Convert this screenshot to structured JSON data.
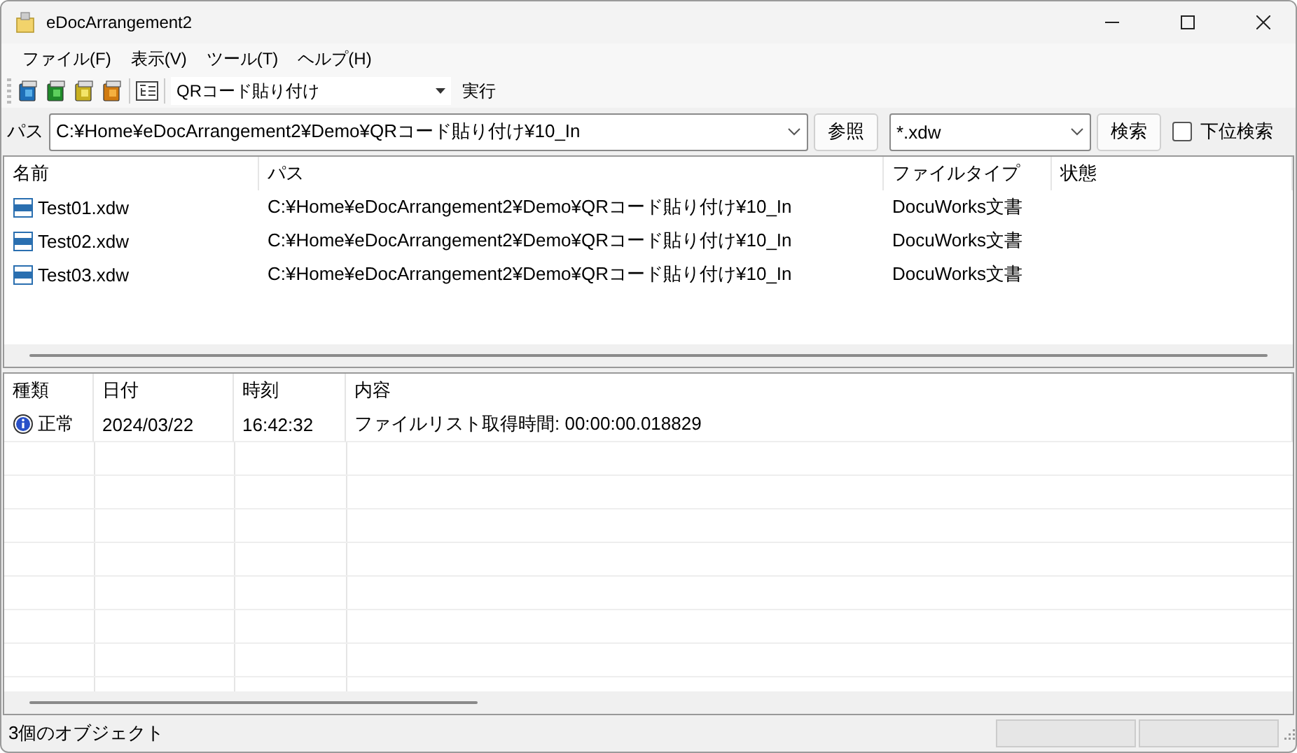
{
  "window": {
    "title": "eDocArrangement2"
  },
  "menu": [
    "ファイル(F)",
    "表示(V)",
    "ツール(T)",
    "ヘルプ(H)"
  ],
  "toolbar": {
    "action_combo": {
      "value": "QRコード貼り付け"
    },
    "run_button": "実行"
  },
  "path_bar": {
    "label": "パス",
    "path": "C:¥Home¥eDocArrangement2¥Demo¥QRコード貼り付け¥10_In",
    "browse_button": "参照",
    "filter": "*.xdw",
    "search_button": "検索",
    "subfolder_checkbox": {
      "label": "下位検索",
      "checked": false
    }
  },
  "file_list": {
    "columns": [
      "名前",
      "パス",
      "ファイルタイプ",
      "状態"
    ],
    "rows": [
      {
        "name": "Test01.xdw",
        "path": "C:¥Home¥eDocArrangement2¥Demo¥QRコード貼り付け¥10_In",
        "type": "DocuWorks文書"
      },
      {
        "name": "Test02.xdw",
        "path": "C:¥Home¥eDocArrangement2¥Demo¥QRコード貼り付け¥10_In",
        "type": "DocuWorks文書"
      },
      {
        "name": "Test03.xdw",
        "path": "C:¥Home¥eDocArrangement2¥Demo¥QRコード貼り付け¥10_In",
        "type": "DocuWorks文書"
      }
    ]
  },
  "log": {
    "columns": [
      "種類",
      "日付",
      "時刻",
      "内容"
    ],
    "rows": [
      {
        "kind": "info",
        "level_text": "正常",
        "date": "2024/03/22",
        "time": "16:42:32",
        "message": "ファイルリスト取得時間: 00:00:00.018829"
      }
    ]
  },
  "status_bar": {
    "text": "3個のオブジェクト"
  }
}
